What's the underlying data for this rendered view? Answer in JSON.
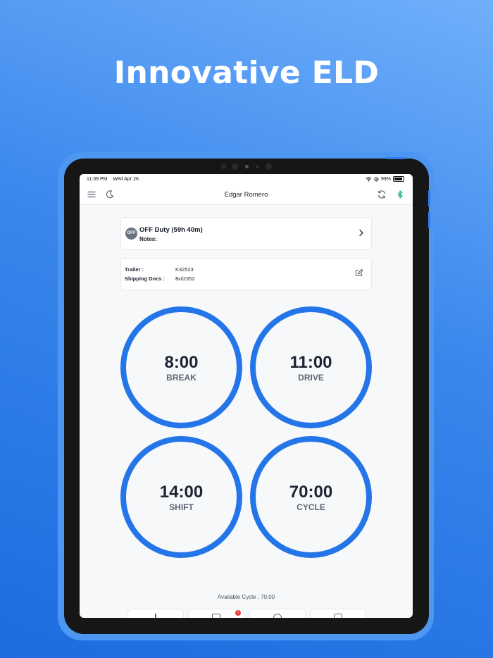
{
  "headline": "Innovative ELD",
  "status_bar": {
    "time": "11:39 PM",
    "date": "Wed Apr 26",
    "battery": "99%"
  },
  "header": {
    "title": "Edgar Romero",
    "icons": [
      "menu-icon",
      "moon-icon",
      "sync-icon",
      "bluetooth-icon"
    ],
    "bluetooth_color": "#22b573"
  },
  "duty": {
    "badge": "OFF",
    "status": "OFF Duty (59h 40m)",
    "notes_label": "Notes:"
  },
  "shipment": {
    "trailer_label": "Trailer :",
    "trailer_value": "K32523",
    "docs_label": "Shipping Docs :",
    "docs_value": "Bol2352"
  },
  "gauges": [
    {
      "value": "8:00",
      "label": "BREAK"
    },
    {
      "value": "11:00",
      "label": "DRIVE"
    },
    {
      "value": "14:00",
      "label": "SHIFT"
    },
    {
      "value": "70:00",
      "label": "CYCLE"
    }
  ],
  "available_cycle": "Available Cycle : 70:00",
  "tab_bar": {
    "notification_count": "!"
  },
  "colors": {
    "accent": "#2475e8",
    "background_top": "#6fb0fb",
    "background_bottom": "#1c6ce0",
    "off_badge": "#6a7180",
    "alert": "#e53935"
  }
}
